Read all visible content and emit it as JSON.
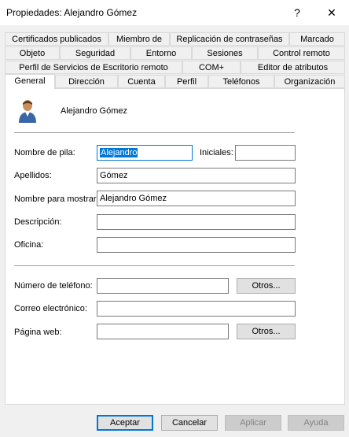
{
  "window": {
    "title": "Propiedades: Alejandro Gómez",
    "help_label": "?",
    "close_label": "✕"
  },
  "tabs": {
    "row1": [
      "Certificados publicados",
      "Miembro de",
      "Replicación de contraseñas",
      "Marcado"
    ],
    "row2": [
      "Objeto",
      "Seguridad",
      "Entorno",
      "Sesiones",
      "Control remoto"
    ],
    "row3": [
      "Perfil de Servicios de Escritorio remoto",
      "COM+",
      "Editor de atributos"
    ],
    "row4": [
      "General",
      "Dirección",
      "Cuenta",
      "Perfil",
      "Teléfonos",
      "Organización"
    ],
    "active": "General"
  },
  "general": {
    "user_icon": "user-icon",
    "display_name": "Alejandro Gómez",
    "first_name_label": "Nombre de pila:",
    "first_name_value": "Alejandro",
    "initials_label": "Iniciales:",
    "initials_value": "",
    "last_name_label": "Apellidos:",
    "last_name_value": "Gómez",
    "display_label": "Nombre para mostrar:",
    "display_value": "Alejandro Gómez",
    "description_label": "Descripción:",
    "description_value": "",
    "office_label": "Oficina:",
    "office_value": "",
    "phone_label": "Número de teléfono:",
    "phone_value": "",
    "email_label": "Correo electrónico:",
    "email_value": "",
    "web_label": "Página web:",
    "web_value": "",
    "others_label": "Otros..."
  },
  "footer": {
    "accept": "Aceptar",
    "cancel": "Cancelar",
    "apply": "Aplicar",
    "help": "Ayuda"
  },
  "colors": {
    "accent": "#0078d7"
  }
}
